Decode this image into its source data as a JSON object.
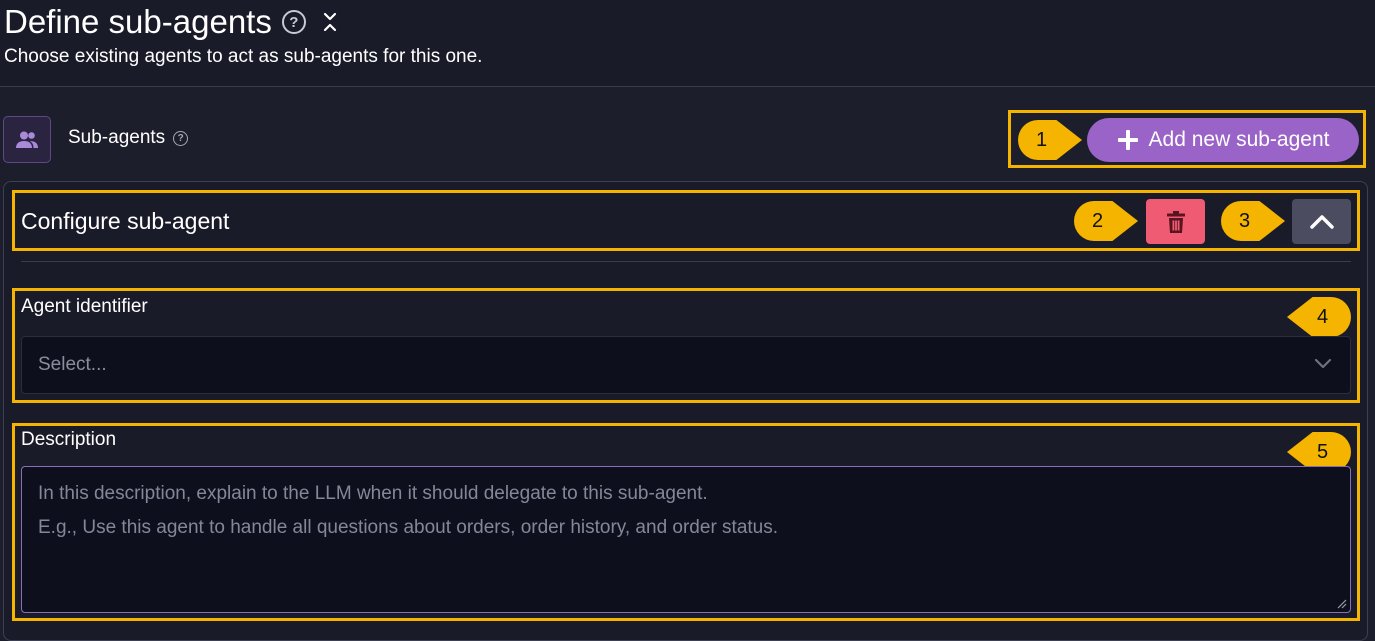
{
  "header": {
    "title": "Define sub-agents",
    "subtitle": "Choose existing agents to act as sub-agents for this one."
  },
  "section": {
    "label": "Sub-agents",
    "add_button_label": "Add new sub-agent"
  },
  "card": {
    "title": "Configure sub-agent",
    "agent_identifier": {
      "label": "Agent identifier",
      "placeholder": "Select..."
    },
    "description": {
      "label": "Description",
      "placeholder_line1": "In this description, explain to the LLM when it should delegate to this sub-agent.",
      "placeholder_line2": "E.g., Use this agent to handle all questions  about orders, order history, and order status."
    }
  },
  "annotations": [
    "1",
    "2",
    "3",
    "4",
    "5"
  ],
  "icons": {
    "help": "help-circle-icon",
    "collapse": "collapse-icon",
    "users": "users-icon",
    "plus": "plus-icon",
    "trash": "trash-icon",
    "chevron_up": "chevron-up-icon",
    "chevron_down": "chevron-down-icon"
  },
  "colors": {
    "highlight": "#f5b400",
    "primary": "#9a63c8",
    "danger": "#ef5b72",
    "background": "#1d1e2b"
  }
}
